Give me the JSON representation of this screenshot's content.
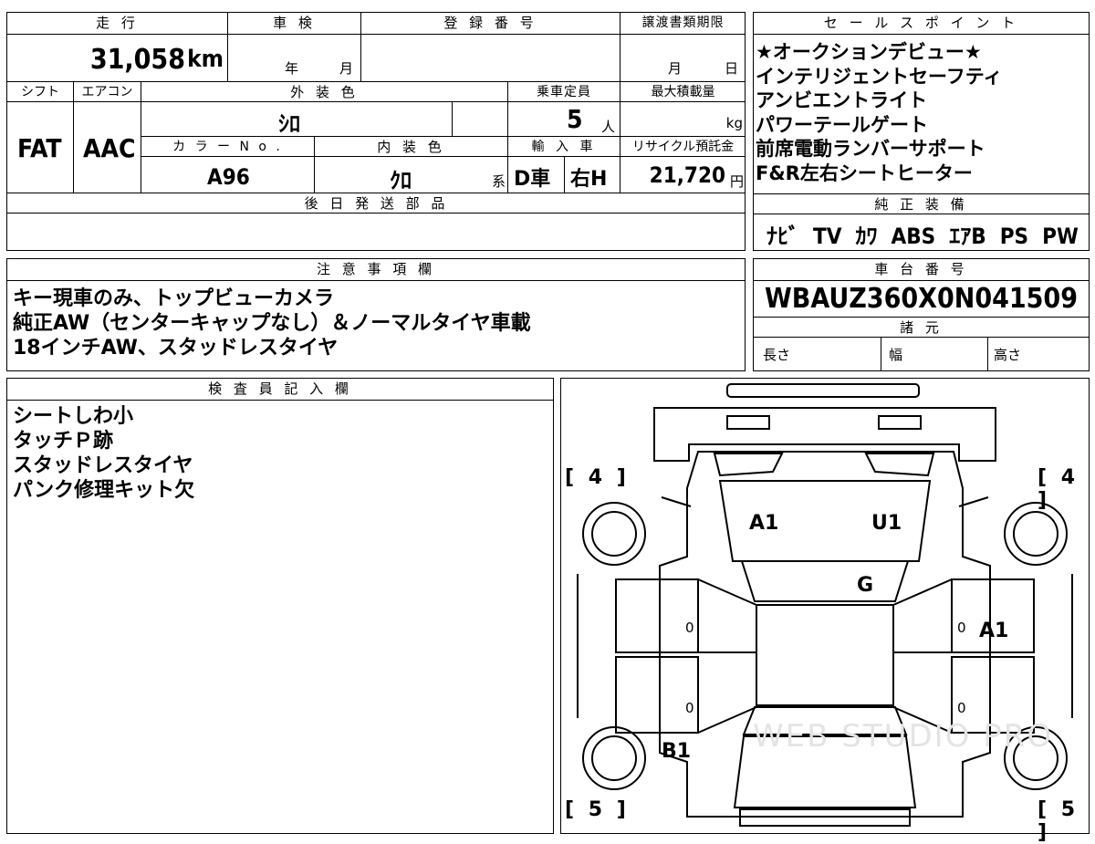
{
  "left_table": {
    "mileage_header": "走 行",
    "mileage": "31,058",
    "mileage_unit": "km",
    "shaken_header": "車 検",
    "shaken_year": "年",
    "shaken_month": "月",
    "reg_header": "登 録 番 号",
    "transfer_header": "譲渡書類期限",
    "transfer_month": "月",
    "transfer_day": "日",
    "shift_header": "シフト",
    "shift": "FAT",
    "ac_header": "エアコン",
    "ac": "AAC",
    "exterior_header": "外 装 色",
    "exterior": "ｼﾛ",
    "capacity_header": "乗車定員",
    "capacity": "5",
    "capacity_unit": "人",
    "maxload_header": "最大積載量",
    "maxload_unit": "kg",
    "color_no_header": "カ ラ ー N o .",
    "color_no": "A96",
    "interior_header": "内 装 色",
    "interior": "ｸﾛ",
    "interior_suffix": "系",
    "import_header": "輸 入 車",
    "import_d": "D車",
    "import_h": "右H",
    "recycle_header": "リサイクル預託金",
    "recycle": "21,720",
    "recycle_unit": "円",
    "later_parts_header": "後 日 発 送 部 品"
  },
  "sales_points": {
    "header": "セ ー ル ス ポ イ ン ト",
    "items": [
      "★オークションデビュー★",
      "インテリジェントセーフティ",
      "アンビエントライト",
      "パワーテールゲート",
      "前席電動ランバーサポート",
      "F&R左右シートヒーター"
    ]
  },
  "equipment": {
    "header": "純 正 装 備",
    "items": "ﾅﾋﾞ  TV  ｶﾜ  ABS  ｴｱB  PS  PW"
  },
  "notes": {
    "header": "注 意 事 項 欄",
    "lines": [
      "キー現車のみ、トップビューカメラ",
      "純正AW（センターキャップなし）＆ノーマルタイヤ車載",
      "18インチAW、スタッドレスタイヤ"
    ]
  },
  "vin": {
    "header": "車 台 番 号",
    "value": "WBAUZ360X0N041509",
    "spec_header": "諸 元",
    "length": "長さ",
    "width": "幅",
    "height": "高さ"
  },
  "inspector": {
    "header": "検 査 員 記 入 欄",
    "lines": [
      "シートしわ小",
      "タッチＰ跡",
      "スタッドレスタイヤ",
      "パンク修理キット欠"
    ]
  },
  "diagram": {
    "tire_fl": "4",
    "tire_fr": "4",
    "tire_rl": "5",
    "tire_rr": "5",
    "mark_a1_hood": "A1",
    "mark_u1": "U1",
    "mark_g": "G",
    "mark_a1_right": "A1",
    "mark_b1": "B1",
    "zero": "0",
    "watermark": "WEB STUDIO PRO"
  }
}
